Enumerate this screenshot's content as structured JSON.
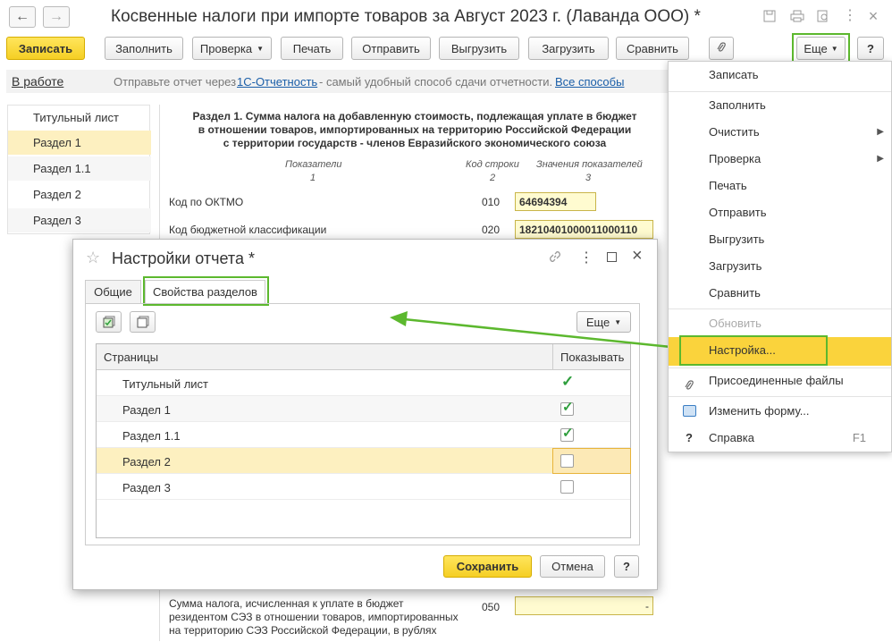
{
  "window": {
    "title": "Косвенные налоги при импорте товаров за Август 2023 г. (Лаванда ООО) *"
  },
  "toolbar": {
    "save": "Записать",
    "fill": "Заполнить",
    "check": "Проверка",
    "print": "Печать",
    "send": "Отправить",
    "export": "Выгрузить",
    "import": "Загрузить",
    "compare": "Сравнить",
    "more": "Еще",
    "help": "?"
  },
  "infobar": {
    "status": "В работе",
    "text_before": "Отправьте отчет через",
    "link1": "1С-Отчетность",
    "text_after": "- самый удобный способ сдачи отчетности.",
    "link2": "Все способы"
  },
  "sidebar": {
    "items": [
      {
        "label": "Титульный лист"
      },
      {
        "label": "Раздел 1"
      },
      {
        "label": "Раздел 1.1"
      },
      {
        "label": "Раздел 2"
      },
      {
        "label": "Раздел 3"
      }
    ]
  },
  "document": {
    "heading_l1": "Раздел 1. Сумма налога на добавленную стоимость, подлежащая уплате в бюджет",
    "heading_l2": "в отношении товаров, импортированных на территорию Российской Федерации",
    "heading_l3": "с территории государств - членов Евразийского экономического союза",
    "col1_label": "Показатели",
    "col1_num": "1",
    "col2_label": "Код строки",
    "col2_num": "2",
    "col3_label": "Значения показателей",
    "col3_num": "3",
    "rows": [
      {
        "label": "Код по ОКТМО",
        "code": "010",
        "value": "64694394"
      },
      {
        "label": "Код бюджетной классификации",
        "code": "020",
        "value": "18210401000011000110"
      }
    ],
    "bottom_row": {
      "label_l1": "Сумма налога, исчисленная к уплате в бюджет",
      "label_l2": "резидентом СЭЗ в отношении товаров, импортированных",
      "label_l3": "на территорию СЭЗ Российской Федерации, в рублях",
      "code": "050",
      "value": "-"
    }
  },
  "dialog": {
    "title": "Настройки отчета *",
    "tabs": [
      {
        "label": "Общие"
      },
      {
        "label": "Свойства разделов"
      }
    ],
    "more": "Еще",
    "col_pages": "Страницы",
    "col_show": "Показывать",
    "rows": [
      {
        "label": "Титульный лист",
        "show": "always"
      },
      {
        "label": "Раздел 1",
        "show": "checked"
      },
      {
        "label": "Раздел 1.1",
        "show": "checked"
      },
      {
        "label": "Раздел 2",
        "show": "unchecked"
      },
      {
        "label": "Раздел 3",
        "show": "unchecked"
      }
    ],
    "save": "Сохранить",
    "cancel": "Отмена",
    "help": "?"
  },
  "menu": {
    "items": [
      {
        "label": "Записать"
      },
      {
        "label": "Заполнить"
      },
      {
        "label": "Очистить"
      },
      {
        "label": "Проверка"
      },
      {
        "label": "Печать"
      },
      {
        "label": "Отправить"
      },
      {
        "label": "Выгрузить"
      },
      {
        "label": "Загрузить"
      },
      {
        "label": "Сравнить"
      },
      {
        "label": "Обновить"
      },
      {
        "label": "Настройка..."
      },
      {
        "label": "Присоединенные файлы"
      },
      {
        "label": "Изменить форму..."
      },
      {
        "label": "Справка",
        "shortcut": "F1"
      }
    ]
  },
  "colors": {
    "accent_yellow": "#f5cf24",
    "highlight_green": "#5cb82e",
    "selected_row": "#fdf0c0",
    "link": "#1a5ea8"
  }
}
